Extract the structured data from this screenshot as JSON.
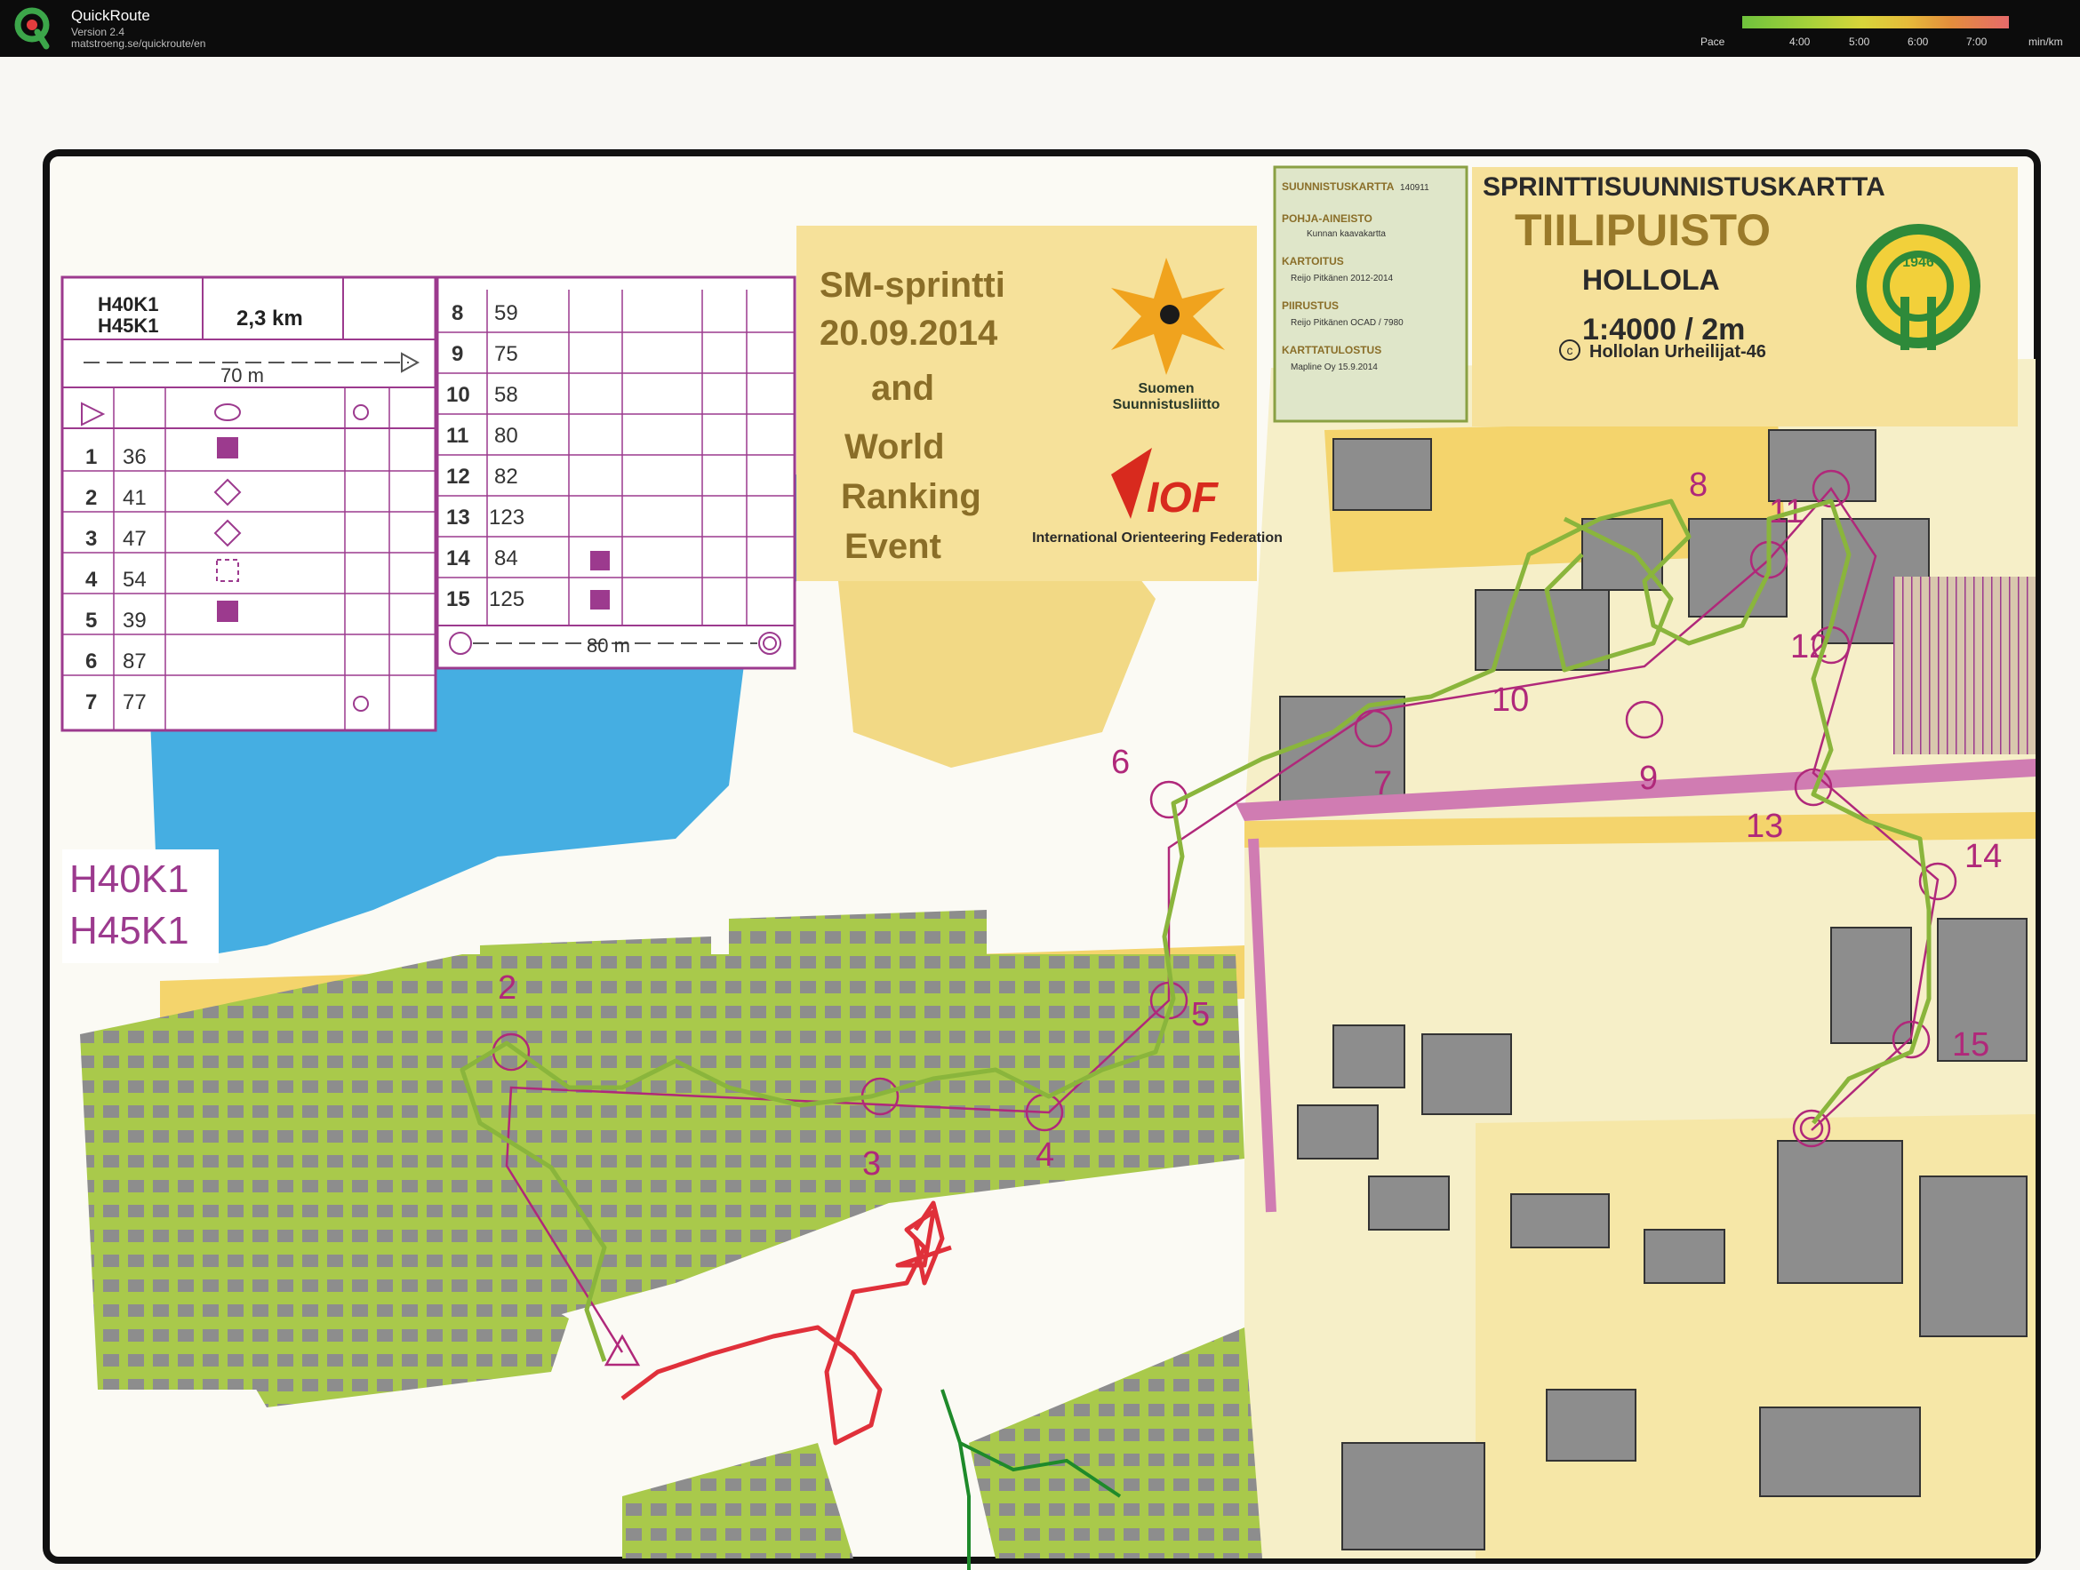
{
  "app": {
    "title": "QuickRoute",
    "version": "Version 2.4",
    "url": "matstroeng.se/quickroute/en"
  },
  "pace_scale": {
    "label": "Pace",
    "ticks": [
      "4:00",
      "5:00",
      "6:00",
      "7:00"
    ],
    "unit": "min/km"
  },
  "event": {
    "line1": "SM-sprintti",
    "line2": "20.09.2014",
    "line3": "and",
    "line4": "World",
    "line5": "Ranking",
    "line6": "Event"
  },
  "federations": {
    "suomen_line1": "Suomen",
    "suomen_line2": "Suunnistusliitto",
    "iof_logo_text": "IOF",
    "iof_name": "International Orienteering Federation"
  },
  "map_title": {
    "title": "SPRINTTISUUNNISTUSKARTTA",
    "name": "TIILIPUISTO",
    "place": "HOLLOLA",
    "scale": "1:4000 / 2m",
    "club": "Hollolan Urheilijat-46",
    "copyright_symbol": "c",
    "emblem_year": "1946"
  },
  "credits": {
    "map_id_label": "SUUNNISTUSKARTTA",
    "map_id": "140911",
    "base_label": "POHJA-AINEISTO",
    "base_value": "Kunnan kaavakartta",
    "survey_label": "KARTOITUS",
    "survey_value": "Reijo Pitkänen 2012-2014",
    "drawing_label": "PIIRUSTUS",
    "drawing_value": "Reijo Pitkänen OCAD / 7980",
    "print_label": "KARTTATULOSTUS",
    "print_value": "Mapline Oy 15.9.2014"
  },
  "course": {
    "classes": [
      "H40K1",
      "H45K1"
    ],
    "length": "2,3 km",
    "start_tape": "70 m",
    "finish_tape": "80 m",
    "controls_left": [
      {
        "num": "1",
        "code": "36"
      },
      {
        "num": "2",
        "code": "41"
      },
      {
        "num": "3",
        "code": "47"
      },
      {
        "num": "4",
        "code": "54"
      },
      {
        "num": "5",
        "code": "39"
      },
      {
        "num": "6",
        "code": "87"
      },
      {
        "num": "7",
        "code": "77"
      }
    ],
    "controls_right": [
      {
        "num": "8",
        "code": "59"
      },
      {
        "num": "9",
        "code": "75"
      },
      {
        "num": "10",
        "code": "58"
      },
      {
        "num": "11",
        "code": "80"
      },
      {
        "num": "12",
        "code": "82"
      },
      {
        "num": "13",
        "code": "123"
      },
      {
        "num": "14",
        "code": "84"
      },
      {
        "num": "15",
        "code": "125"
      }
    ],
    "map_class_label_1": "H40K1",
    "map_class_label_2": "H45K1"
  },
  "map_control_labels": [
    "2",
    "3",
    "4",
    "5",
    "6",
    "7",
    "8",
    "9",
    "10",
    "11",
    "12",
    "13",
    "14",
    "15"
  ],
  "colors": {
    "course_purple": "#b0287a",
    "route_green": "#8ab53c",
    "route_red": "#e0303a",
    "route_dark_green": "#1e8a2a",
    "lake_blue": "#45aee2",
    "building_gray": "#8d8d8d",
    "paved_yellow": "#f4d46c",
    "private_olive": "#a9c94b"
  }
}
